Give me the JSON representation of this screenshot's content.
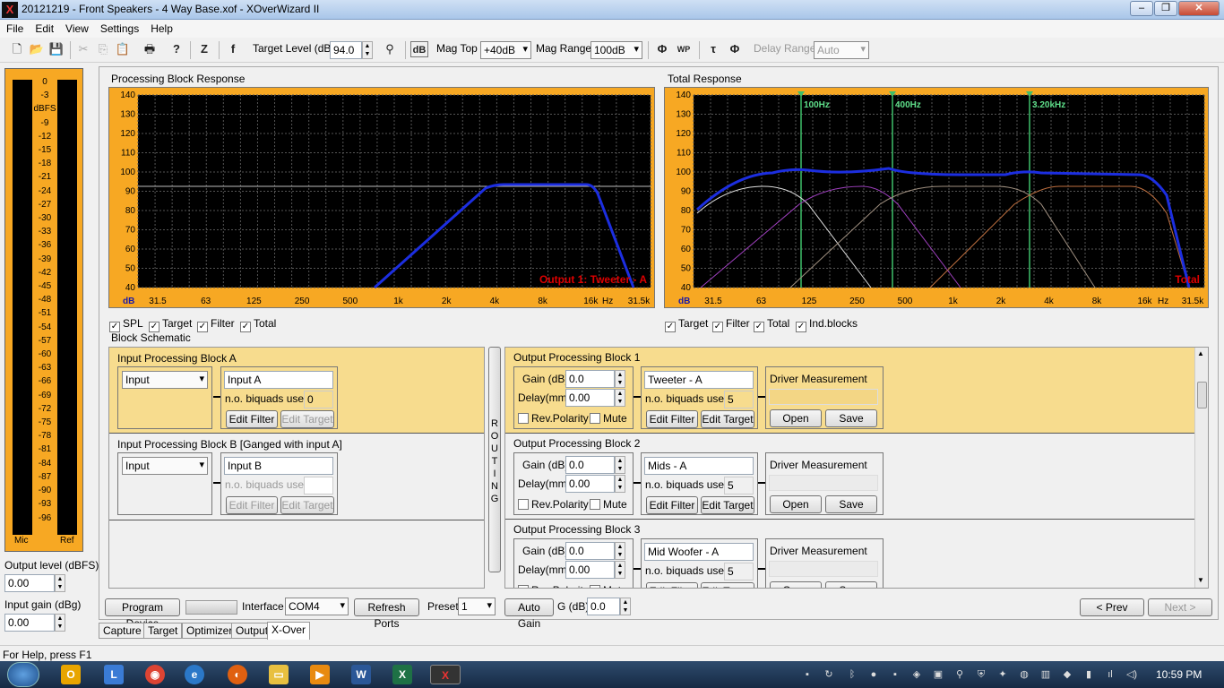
{
  "window": {
    "title": "20121219 - Front Speakers - 4 Way Base.xof - XOverWizard II"
  },
  "menu": [
    "File",
    "Edit",
    "View",
    "Settings",
    "Help"
  ],
  "toolbar": {
    "target_level_label": "Target Level (dB)",
    "target_level": "94.0",
    "db_label": "dB",
    "mag_top_label": "Mag Top",
    "mag_top": "+40dB",
    "mag_range_label": "Mag Range",
    "mag_range": "100dB",
    "delay_range_label": "Delay Range",
    "delay_range": "Auto"
  },
  "meter": {
    "scale": [
      "0",
      "-3",
      "dBFS",
      "-9",
      "-12",
      "-15",
      "-18",
      "-21",
      "-24",
      "-27",
      "-30",
      "-33",
      "-36",
      "-39",
      "-42",
      "-45",
      "-48",
      "-51",
      "-54",
      "-57",
      "-60",
      "-63",
      "-66",
      "-69",
      "-72",
      "-75",
      "-78",
      "-81",
      "-84",
      "-87",
      "-90",
      "-93",
      "-96"
    ],
    "mic": "Mic",
    "ref": "Ref",
    "output_level_label": "Output level (dBFS)",
    "output_level": "0.00",
    "input_gain_label": "Input gain (dBg)",
    "input_gain": "0.00"
  },
  "plots": {
    "left_title": "Processing Block Response",
    "right_title": "Total Response",
    "y_ticks": [
      "140",
      "130",
      "120",
      "110",
      "100",
      "90",
      "80",
      "70",
      "60",
      "50",
      "40"
    ],
    "x_ticks": [
      "31.5",
      "63",
      "125",
      "250",
      "500",
      "1k",
      "2k",
      "4k",
      "8k",
      "16k",
      "31.5k"
    ],
    "y_unit": "dB",
    "x_unit": "Hz",
    "left_caption": "Output 1: Tweeter - A",
    "right_caption": "Total",
    "markers": [
      "100Hz",
      "400Hz",
      "3.20kHz"
    ]
  },
  "left_checks": [
    "SPL",
    "Target",
    "Filter",
    "Total"
  ],
  "right_checks": [
    "Target",
    "Filter",
    "Total",
    "Ind.blocks"
  ],
  "schematic": {
    "title": "Block Schematic",
    "routing": "ROUTING",
    "input_blocks": [
      {
        "title": "Input Processing Block A",
        "select": "Input",
        "name": "Input A",
        "biquads_label": "n.o. biquads used",
        "biquads": "0",
        "edit_filter": "Edit Filter",
        "edit_target": "Edit Target"
      },
      {
        "title": "Input Processing Block B [Ganged with input A]",
        "select": "Input",
        "name": "Input B",
        "biquads_label": "n.o. biquads used",
        "biquads": "",
        "edit_filter": "Edit Filter",
        "edit_target": "Edit Target"
      }
    ],
    "output_blocks": [
      {
        "title": "Output Processing Block 1",
        "gain_label": "Gain (dB)",
        "gain": "0.0",
        "delay_label": "Delay(mm)",
        "delay": "0.00",
        "rev": "Rev.Polarity",
        "mute": "Mute",
        "name": "Tweeter - A",
        "biquads_label": "n.o. biquads used",
        "biquads": "5",
        "edit_filter": "Edit Filter",
        "edit_target": "Edit Target",
        "dm": "Driver Measurement",
        "open": "Open",
        "save": "Save"
      },
      {
        "title": "Output Processing Block 2",
        "gain_label": "Gain (dB)",
        "gain": "0.0",
        "delay_label": "Delay(mm)",
        "delay": "0.00",
        "rev": "Rev.Polarity",
        "mute": "Mute",
        "name": "Mids - A",
        "biquads_label": "n.o. biquads used",
        "biquads": "5",
        "edit_filter": "Edit Filter",
        "edit_target": "Edit Target",
        "dm": "Driver Measurement",
        "open": "Open",
        "save": "Save"
      },
      {
        "title": "Output Processing Block 3",
        "gain_label": "Gain (dB)",
        "gain": "0.0",
        "delay_label": "Delay(mm)",
        "delay": "0.00",
        "rev": "Rev.Polarity",
        "mute": "Mute",
        "name": "Mid Woofer - A",
        "biquads_label": "n.o. biquads used",
        "biquads": "5",
        "edit_filter": "Edit Filter",
        "edit_target": "Edit Target",
        "dm": "Driver Measurement",
        "open": "Open",
        "save": "Save"
      }
    ]
  },
  "bottom": {
    "program": "Program Device",
    "interface_label": "Interface",
    "interface": "COM4",
    "refresh": "Refresh Ports",
    "preset_label": "Preset",
    "preset": "1",
    "auto_gain": "Auto Gain",
    "g_label": "G (dB)",
    "g": "0.0",
    "prev": "< Prev",
    "next": "Next >"
  },
  "tabs": [
    "Capture",
    "Target",
    "Optimizer",
    "Output",
    "X-Over"
  ],
  "status": "For Help, press F1",
  "clock": "10:59 PM"
}
